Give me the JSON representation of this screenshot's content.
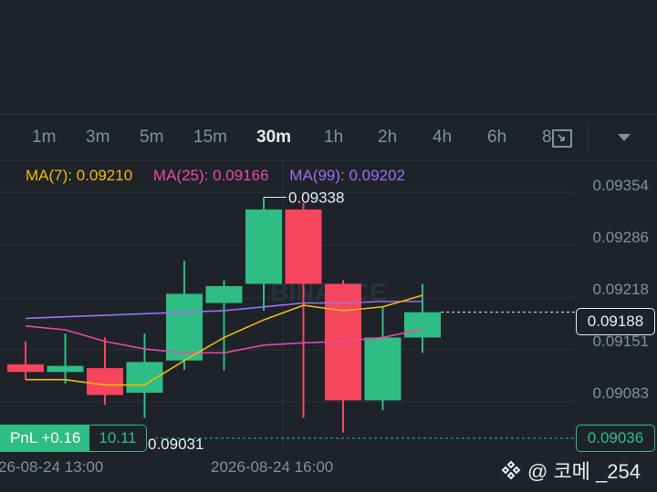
{
  "timeframes": [
    {
      "label": "1m",
      "active": false
    },
    {
      "label": "3m",
      "active": false
    },
    {
      "label": "5m",
      "active": false
    },
    {
      "label": "15m",
      "active": false
    },
    {
      "label": "30m",
      "active": true
    },
    {
      "label": "1h",
      "active": false
    },
    {
      "label": "2h",
      "active": false
    },
    {
      "label": "4h",
      "active": false
    },
    {
      "label": "6h",
      "active": false
    },
    {
      "label": "8",
      "active": false
    }
  ],
  "ma": {
    "ma7": {
      "label": "MA(7): 0.09210",
      "color": "#f0b90b"
    },
    "ma25": {
      "label": "MA(25): 0.09166",
      "color": "#e84aa6"
    },
    "ma99": {
      "label": "MA(99): 0.09202",
      "color": "#9b6ff0"
    }
  },
  "price_axis": [
    "0.09354",
    "0.09286",
    "0.09218",
    "0.09151",
    "0.09083"
  ],
  "current_price": "0.09188",
  "low_price_tag": "0.09036",
  "high_annotation": "0.09338",
  "low_annotation": "0.09031",
  "pnl": {
    "label": "PnL +0.16",
    "value": "10.11"
  },
  "time_labels": [
    "26-08-24 13:00",
    "2026-08-24 16:00"
  ],
  "watermark": "BINANCE",
  "user_tag": "@ 코메 _254",
  "colors": {
    "up": "#2ebd85",
    "down": "#f6465d",
    "bg": "#1e2329"
  },
  "chart_data": {
    "type": "candlestick",
    "candles": [
      {
        "open": 0.0912,
        "high": 0.0915,
        "low": 0.091,
        "close": 0.0911
      },
      {
        "open": 0.0911,
        "high": 0.0916,
        "low": 0.09095,
        "close": 0.09118
      },
      {
        "open": 0.09115,
        "high": 0.09155,
        "low": 0.09067,
        "close": 0.0908
      },
      {
        "open": 0.09083,
        "high": 0.0916,
        "low": 0.0905,
        "close": 0.09123
      },
      {
        "open": 0.09125,
        "high": 0.09255,
        "low": 0.09113,
        "close": 0.09212
      },
      {
        "open": 0.092,
        "high": 0.0923,
        "low": 0.09112,
        "close": 0.09222
      },
      {
        "open": 0.09225,
        "high": 0.09338,
        "low": 0.0919,
        "close": 0.09322
      },
      {
        "open": 0.09322,
        "high": 0.0933,
        "low": 0.0905,
        "close": 0.09225
      },
      {
        "open": 0.09225,
        "high": 0.0923,
        "low": 0.09031,
        "close": 0.09073
      },
      {
        "open": 0.09073,
        "high": 0.09195,
        "low": 0.0906,
        "close": 0.09155
      },
      {
        "open": 0.09155,
        "high": 0.09225,
        "low": 0.09135,
        "close": 0.09188
      }
    ],
    "ma7": [
      0.091,
      0.091,
      0.09093,
      0.09093,
      0.09125,
      0.09155,
      0.09178,
      0.09197,
      0.0919,
      0.09195,
      0.0921
    ],
    "ma25": [
      0.0917,
      0.09165,
      0.0915,
      0.0914,
      0.09135,
      0.09135,
      0.09145,
      0.09148,
      0.0915,
      0.09155,
      0.09166
    ],
    "ma99": [
      0.0918,
      0.09182,
      0.09184,
      0.09186,
      0.09188,
      0.0919,
      0.09195,
      0.092,
      0.092,
      0.09202,
      0.09202
    ],
    "ylim": [
      0.09031,
      0.09354
    ]
  }
}
